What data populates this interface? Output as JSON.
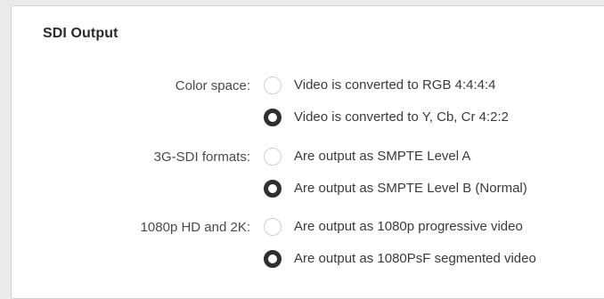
{
  "panel": {
    "title": "SDI Output"
  },
  "groups": [
    {
      "label": "Color space:",
      "options": [
        {
          "label": "Video is converted to RGB 4:4:4:4",
          "selected": false
        },
        {
          "label": "Video is converted to Y, Cb, Cr 4:2:2",
          "selected": true
        }
      ]
    },
    {
      "label": "3G-SDI formats:",
      "options": [
        {
          "label": "Are output as SMPTE Level A",
          "selected": false
        },
        {
          "label": "Are output as SMPTE Level B (Normal)",
          "selected": true
        }
      ]
    },
    {
      "label": "1080p HD and 2K:",
      "options": [
        {
          "label": "Are output as 1080p progressive video",
          "selected": false
        },
        {
          "label": "Are output as 1080PsF segmented video",
          "selected": true
        }
      ]
    }
  ],
  "colors": {
    "background": "#ebebeb",
    "panel": "#ffffff",
    "radio_selected": "#2f2f2f",
    "radio_unselected_border": "#cfcfcf"
  }
}
